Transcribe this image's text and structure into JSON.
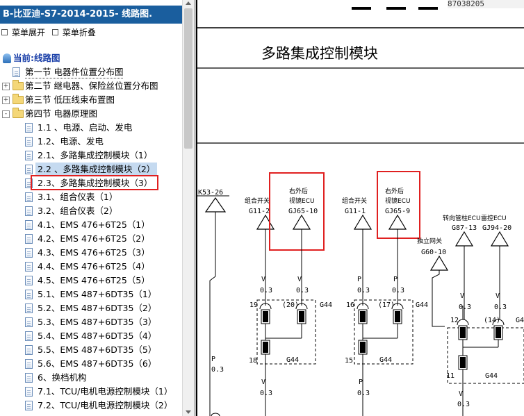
{
  "window": {
    "title": "B-比亚迪-S7-2014-2015- 线路图."
  },
  "menu": {
    "expand": "菜单展开",
    "collapse": "菜单折叠"
  },
  "tree": {
    "root": "当前:线路图",
    "items": [
      {
        "label": "第一节 电器件位置分布图",
        "type": "doc",
        "level": 1,
        "selected": false
      },
      {
        "label": "第二节 继电器、保险丝位置分布图",
        "type": "folder",
        "level": 1,
        "toggle": "+"
      },
      {
        "label": "第三节 低压线束布置图",
        "type": "folder",
        "level": 1,
        "toggle": "+"
      },
      {
        "label": "第四节 电器原理图",
        "type": "folder",
        "level": 1,
        "toggle": "−"
      },
      {
        "label": "1.1 、电源、启动、发电",
        "type": "doc",
        "level": 2
      },
      {
        "label": "1.2、电源、发电",
        "type": "doc",
        "level": 2
      },
      {
        "label": "2.1、多路集成控制模块（1）",
        "type": "doc",
        "level": 2
      },
      {
        "label": "2.2 、多路集成控制模块（2）",
        "type": "doc",
        "level": 2,
        "selected": true
      },
      {
        "label": "2.3、多路集成控制模块（3）",
        "type": "doc",
        "level": 2,
        "highlight": true
      },
      {
        "label": "3.1、组合仪表（1）",
        "type": "doc",
        "level": 2
      },
      {
        "label": "3.2、组合仪表（2）",
        "type": "doc",
        "level": 2
      },
      {
        "label": "4.1、EMS 476+6T25（1）",
        "type": "doc",
        "level": 2
      },
      {
        "label": "4.2、EMS 476+6T25（2）",
        "type": "doc",
        "level": 2
      },
      {
        "label": "4.3、EMS 476+6T25（3）",
        "type": "doc",
        "level": 2
      },
      {
        "label": "4.4、EMS 476+6T25（4）",
        "type": "doc",
        "level": 2
      },
      {
        "label": "4.5、EMS 476+6T25（5）",
        "type": "doc",
        "level": 2
      },
      {
        "label": "5.1、EMS 487+6DT35（1）",
        "type": "doc",
        "level": 2
      },
      {
        "label": "5.2、EMS 487+6DT35（2）",
        "type": "doc",
        "level": 2
      },
      {
        "label": "5.3、EMS 487+6DT35（3）",
        "type": "doc",
        "level": 2
      },
      {
        "label": "5.4、EMS 487+6DT35（4）",
        "type": "doc",
        "level": 2
      },
      {
        "label": "5.5、EMS 487+6DT35（5）",
        "type": "doc",
        "level": 2
      },
      {
        "label": "5.6、EMS 487+6DT35（6）",
        "type": "doc",
        "level": 2
      },
      {
        "label": "6、换档机构",
        "type": "doc",
        "level": 2
      },
      {
        "label": "7.1、TCU/电机电源控制模块（1）",
        "type": "doc",
        "level": 2
      },
      {
        "label": "7.2、TCU/电机电源控制模块（2）",
        "type": "doc",
        "level": 2
      }
    ]
  },
  "diagram": {
    "top_code": "87038205",
    "title": "多路集成控制模块",
    "left_connector": "K53-26",
    "left_wire": {
      "color": "P",
      "size": "0.3"
    },
    "groups": [
      {
        "label1": "组合开关",
        "pin": "G11-2"
      },
      {
        "label1": "右外后",
        "label2": "视镜ECU",
        "pin": "GJ65-10"
      },
      {
        "label1": "组合开关",
        "pin": "G11-1"
      },
      {
        "label1": "右外后",
        "label2": "视镜ECU",
        "pin": "GJ65-9"
      },
      {
        "label1": "独立网关",
        "pin": "G60-10"
      },
      {
        "label1": "转向管柱ECU",
        "pin": "G87-13"
      },
      {
        "label1": "雷控ECU",
        "pin": "GJ94-20"
      }
    ],
    "wires": {
      "v": "V",
      "p": "P",
      "size": "0.3"
    },
    "pins": {
      "a19": "19",
      "a20": "(20)",
      "a18": "18",
      "g44a": "G44",
      "g44b": "G44",
      "b16": "16",
      "b17": "(17)",
      "b15": "15",
      "g44c": "G44",
      "g44d": "G44",
      "c12": "12",
      "c14": "(14)",
      "c11": "11",
      "g44e": "G44",
      "g44f": "G4"
    }
  }
}
